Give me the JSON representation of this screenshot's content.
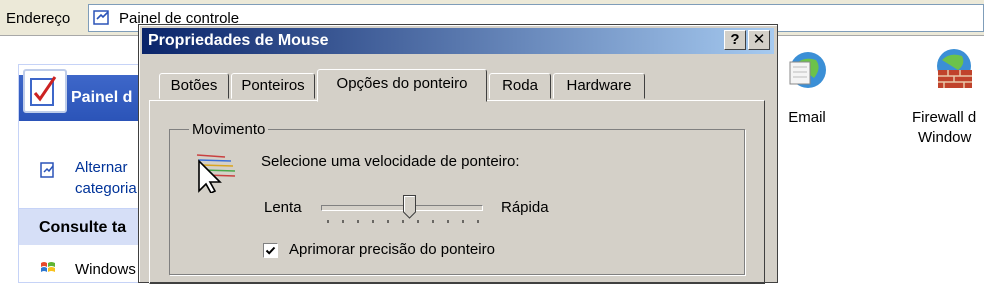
{
  "explorer": {
    "address_label": "Endereço",
    "address_value": "Painel de controle",
    "control_panel_title": "Painel d",
    "switch_link": [
      "Alternar",
      "categoria"
    ],
    "see_also_title": "Consulte ta",
    "see_also_item": "Windows",
    "icons": [
      {
        "name": "email-icon",
        "label": [
          "Email"
        ]
      },
      {
        "name": "firewall-icon",
        "label": [
          "Firewall d",
          "Window"
        ]
      }
    ]
  },
  "dialog": {
    "title": "Propriedades de Mouse",
    "help_button": "?",
    "close_button": "✕",
    "tabs": [
      "Botões",
      "Ponteiros",
      "Opções do ponteiro",
      "Roda",
      "Hardware"
    ],
    "active_tab": 2,
    "motion_group": {
      "title": "Movimento",
      "prompt": "Selecione uma velocidade de ponteiro:",
      "slow_label": "Lenta",
      "fast_label": "Rápida",
      "speed_fraction": 0.55,
      "tick_count": 11,
      "enhance_precision_label": "Aprimorar precisão do ponteiro",
      "enhance_precision_checked": true
    }
  },
  "colors": {
    "titlebar_start": "#0a246a",
    "titlebar_end": "#a6caf0",
    "dialog_face": "#d4d0c8",
    "link": "#003399"
  }
}
